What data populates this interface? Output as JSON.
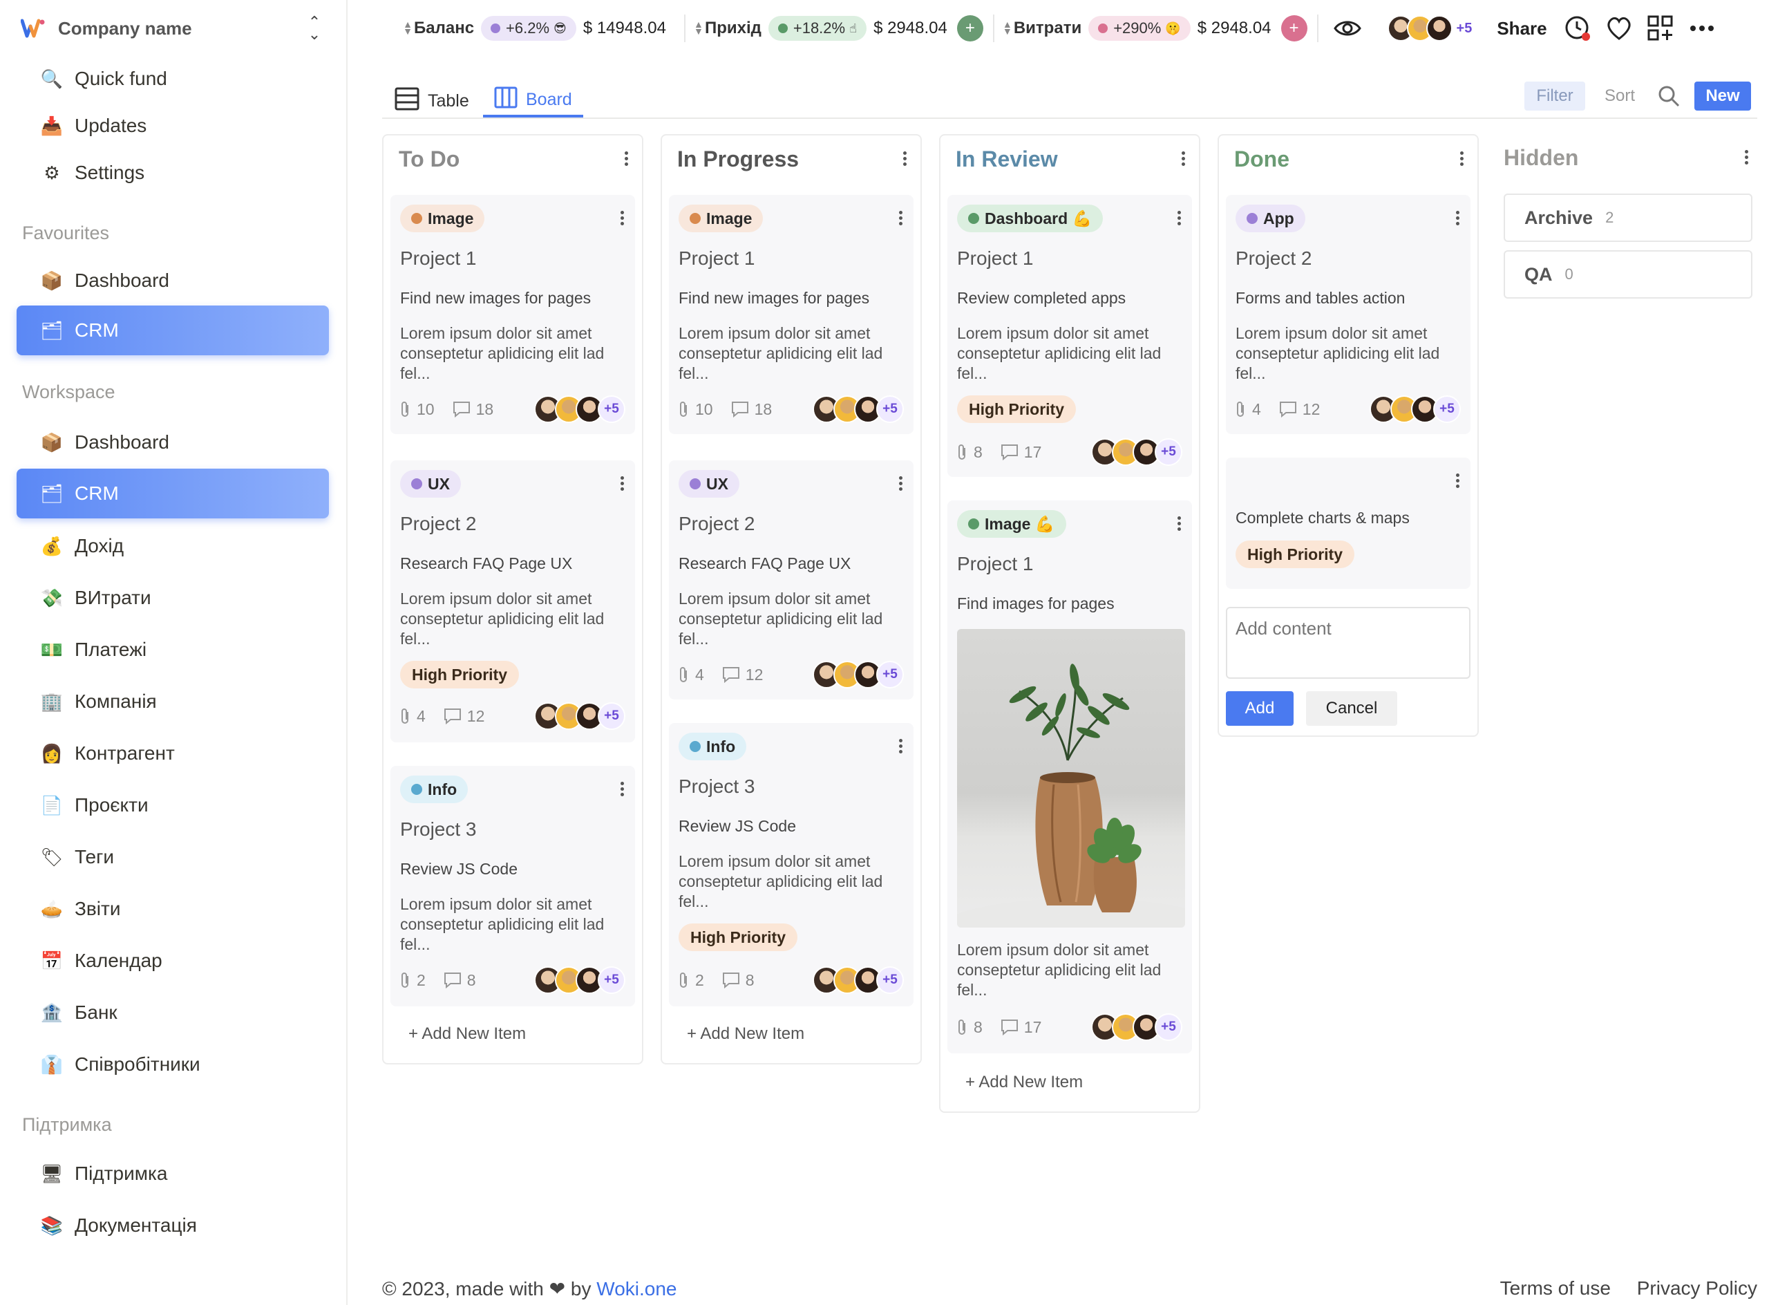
{
  "company": {
    "name": "Company name"
  },
  "sidebar": {
    "top_items": [
      {
        "label": "Quick fund",
        "icon": "magnifier-icon"
      },
      {
        "label": "Updates",
        "icon": "inbox-tray-icon"
      },
      {
        "label": "Settings",
        "icon": "gear-icon"
      }
    ],
    "favourites_label": "Favourites",
    "favourites": [
      {
        "label": "Dashboard",
        "icon": "package-icon"
      },
      {
        "label": "CRM",
        "icon": "crm-icon",
        "active": true
      }
    ],
    "workspace_label": "Workspace",
    "workspace": [
      {
        "label": "Dashboard",
        "icon": "package-icon"
      },
      {
        "label": "CRM",
        "icon": "crm-icon",
        "active": true
      },
      {
        "label": "Дохід",
        "icon": "income-icon"
      },
      {
        "label": "ВИтрати",
        "icon": "expenses-icon"
      },
      {
        "label": "Платежі",
        "icon": "money-icon"
      },
      {
        "label": "Компанія",
        "icon": "office-building-icon"
      },
      {
        "label": "Контрагент",
        "icon": "person-icon"
      },
      {
        "label": "Проєкти",
        "icon": "document-icon"
      },
      {
        "label": "Теги",
        "icon": "tag-icon"
      },
      {
        "label": "Звіти",
        "icon": "chart-pie-icon"
      },
      {
        "label": "Календар",
        "icon": "calendar-icon"
      },
      {
        "label": "Банк",
        "icon": "bank-icon"
      },
      {
        "label": "Співробітники",
        "icon": "employee-icon"
      }
    ],
    "support_label": "Підтримка",
    "support": [
      {
        "label": "Підтримка",
        "icon": "support-icon"
      },
      {
        "label": "Документація",
        "icon": "docs-icon"
      }
    ]
  },
  "topbar": {
    "stats": [
      {
        "label": "Баланс",
        "pct": "+6.2%",
        "emoji": "😎",
        "amount": "$ 14948.04",
        "pill_bg": "#ece6f8",
        "dot": "#9b7fd6"
      },
      {
        "label": "Прихід",
        "pct": "+18.2%",
        "emoji": "☝",
        "amount": "$ 2948.04",
        "pill_bg": "#dcefe0",
        "dot": "#5a9a68",
        "btn": "+",
        "btn_color": "#6a9b73"
      },
      {
        "label": "Витрати",
        "pct": "+290%",
        "emoji": "🤫",
        "amount": "$ 2948.04",
        "pill_bg": "#f8e2ea",
        "dot": "#d9708f",
        "btn": "+",
        "btn_color": "#d9708f"
      }
    ],
    "avatars_more": "+5",
    "share": "Share"
  },
  "views": {
    "table": "Table",
    "board": "Board",
    "filter": "Filter",
    "sort": "Sort",
    "new": "New"
  },
  "board": {
    "columns": [
      {
        "title": "To Do",
        "title_color": "#8a8a8a",
        "cards": [
          {
            "tag": "Image",
            "tag_bg": "#f8e7dc",
            "tag_dot": "#d98a4e",
            "title": "Project 1",
            "sub": "Find new images for pages",
            "body": "Lorem ipsum dolor sit amet conseptetur aplidicing elit lad fel...",
            "attach": "10",
            "comments": "18",
            "more": "+5"
          },
          {
            "tag": "UX",
            "tag_bg": "#ece6f8",
            "tag_dot": "#9b7fd6",
            "title": "Project 2",
            "sub": "Research FAQ Page UX",
            "body": "Lorem ipsum dolor sit amet conseptetur aplidicing elit lad fel...",
            "priority": "High Priority",
            "attach": "4",
            "comments": "12",
            "more": "+5"
          },
          {
            "tag": "Info",
            "tag_bg": "#dff1f8",
            "tag_dot": "#5aa9cf",
            "title": "Project 3",
            "sub": "Review JS Code",
            "body": "Lorem ipsum dolor sit amet conseptetur aplidicing elit lad fel...",
            "attach": "2",
            "comments": "8",
            "more": "+5"
          }
        ],
        "add": "+ Add New Item"
      },
      {
        "title": "In Progress",
        "title_color": "#555555",
        "cards": [
          {
            "tag": "Image",
            "tag_bg": "#f8e7dc",
            "tag_dot": "#d98a4e",
            "title": "Project 1",
            "sub": "Find new images for pages",
            "body": "Lorem ipsum dolor sit amet conseptetur aplidicing elit lad fel...",
            "attach": "10",
            "comments": "18",
            "more": "+5"
          },
          {
            "tag": "UX",
            "tag_bg": "#ece6f8",
            "tag_dot": "#9b7fd6",
            "title": "Project 2",
            "sub": "Research FAQ Page UX",
            "body": "Lorem ipsum dolor sit amet conseptetur aplidicing elit lad fel...",
            "attach": "4",
            "comments": "12",
            "more": "+5"
          },
          {
            "tag": "Info",
            "tag_bg": "#dff1f8",
            "tag_dot": "#5aa9cf",
            "title": "Project 3",
            "sub": "Review JS Code",
            "body": "Lorem ipsum dolor sit amet conseptetur aplidicing elit lad fel...",
            "priority": "High Priority",
            "attach": "2",
            "comments": "8",
            "more": "+5"
          }
        ],
        "add": "+ Add New Item"
      },
      {
        "title": "In Review",
        "title_color": "#5b8aa8",
        "cards": [
          {
            "tag": "Dashboard 💪",
            "tag_bg": "#dcefe0",
            "tag_dot": "#5a9a68",
            "title": "Project 1",
            "sub": "Review completed apps",
            "body": "Lorem ipsum dolor sit amet conseptetur aplidicing elit lad fel...",
            "priority": "High Priority",
            "attach": "8",
            "comments": "17",
            "more": "+5"
          },
          {
            "tag": "Image 💪",
            "tag_bg": "#dcefe0",
            "tag_dot": "#5a9a68",
            "title": "Project 1",
            "sub": "Find images for pages",
            "body": "Lorem ipsum dolor sit amet conseptetur aplidicing elit lad fel...",
            "attach": "8",
            "comments": "17",
            "more": "+5"
          }
        ],
        "add": "+ Add New Item"
      },
      {
        "title": "Done",
        "title_color": "#6a9b73",
        "cards": [
          {
            "tag": "App",
            "tag_bg": "#ece6f8",
            "tag_dot": "#9b7fd6",
            "title": "Project 2",
            "sub": "Forms and tables action",
            "body": "Lorem ipsum dolor sit amet conseptetur aplidicing elit lad fel...",
            "attach": "4",
            "comments": "12",
            "more": "+5"
          },
          {
            "sub": "Complete charts & maps",
            "priority": "High Priority"
          }
        ],
        "add_placeholder": "Add content",
        "add_button": "Add",
        "cancel_button": "Cancel"
      }
    ],
    "hidden": {
      "title": "Hidden",
      "rows": [
        {
          "name": "Archive",
          "count": "2"
        },
        {
          "name": "QA",
          "count": "0"
        }
      ]
    }
  },
  "footer": {
    "copyright": "© 2023, made with",
    "by": "by",
    "brand": "Woki.one",
    "terms": "Terms of use",
    "privacy": "Privacy Policy"
  }
}
